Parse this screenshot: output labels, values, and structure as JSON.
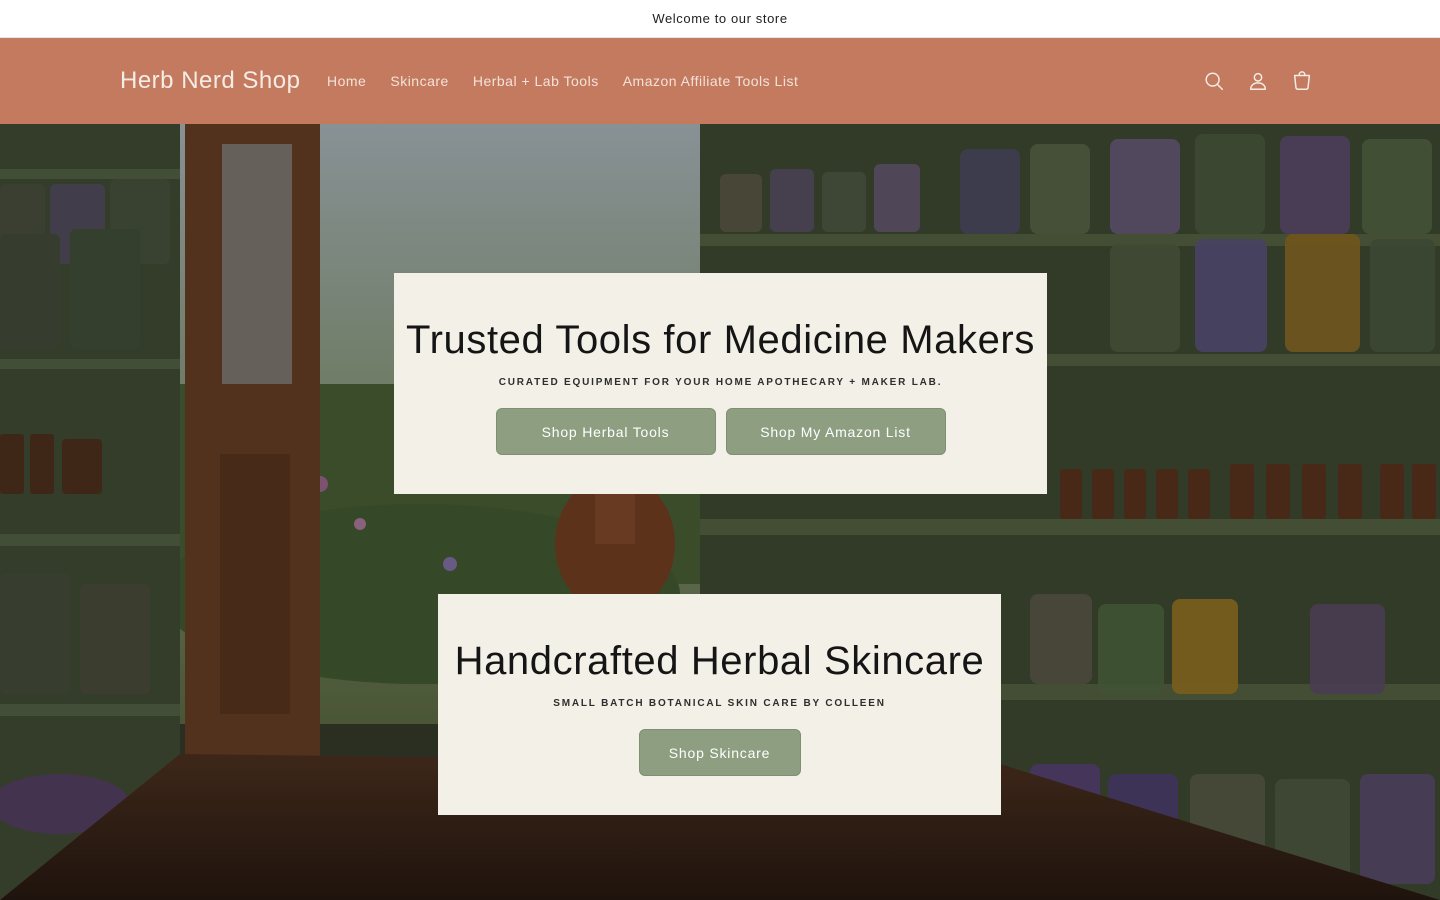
{
  "announcement": {
    "text": "Welcome to our store"
  },
  "header": {
    "logo": "Herb Nerd Shop",
    "nav": [
      {
        "label": "Home"
      },
      {
        "label": "Skincare"
      },
      {
        "label": "Herbal + Lab Tools"
      },
      {
        "label": "Amazon Affiliate Tools List"
      }
    ],
    "icons": [
      "search-icon",
      "account-icon",
      "cart-icon"
    ]
  },
  "hero": {
    "card1": {
      "title": "Trusted Tools for Medicine Makers",
      "subtitle": "CURATED EQUIPMENT FOR YOUR HOME APOTHECARY + MAKER LAB.",
      "button1": "Shop Herbal Tools",
      "button2": "Shop My Amazon List"
    },
    "card2": {
      "title": "Handcrafted Herbal Skincare",
      "subtitle": "SMALL BATCH BOTANICAL SKIN CARE BY COLLEEN",
      "button": "Shop Skincare"
    }
  },
  "colors": {
    "header_bg": "#c47a5f",
    "card_bg": "#f3f0e8",
    "button_bg": "#8e9e80",
    "shelf_green": "#5a6b4a"
  }
}
